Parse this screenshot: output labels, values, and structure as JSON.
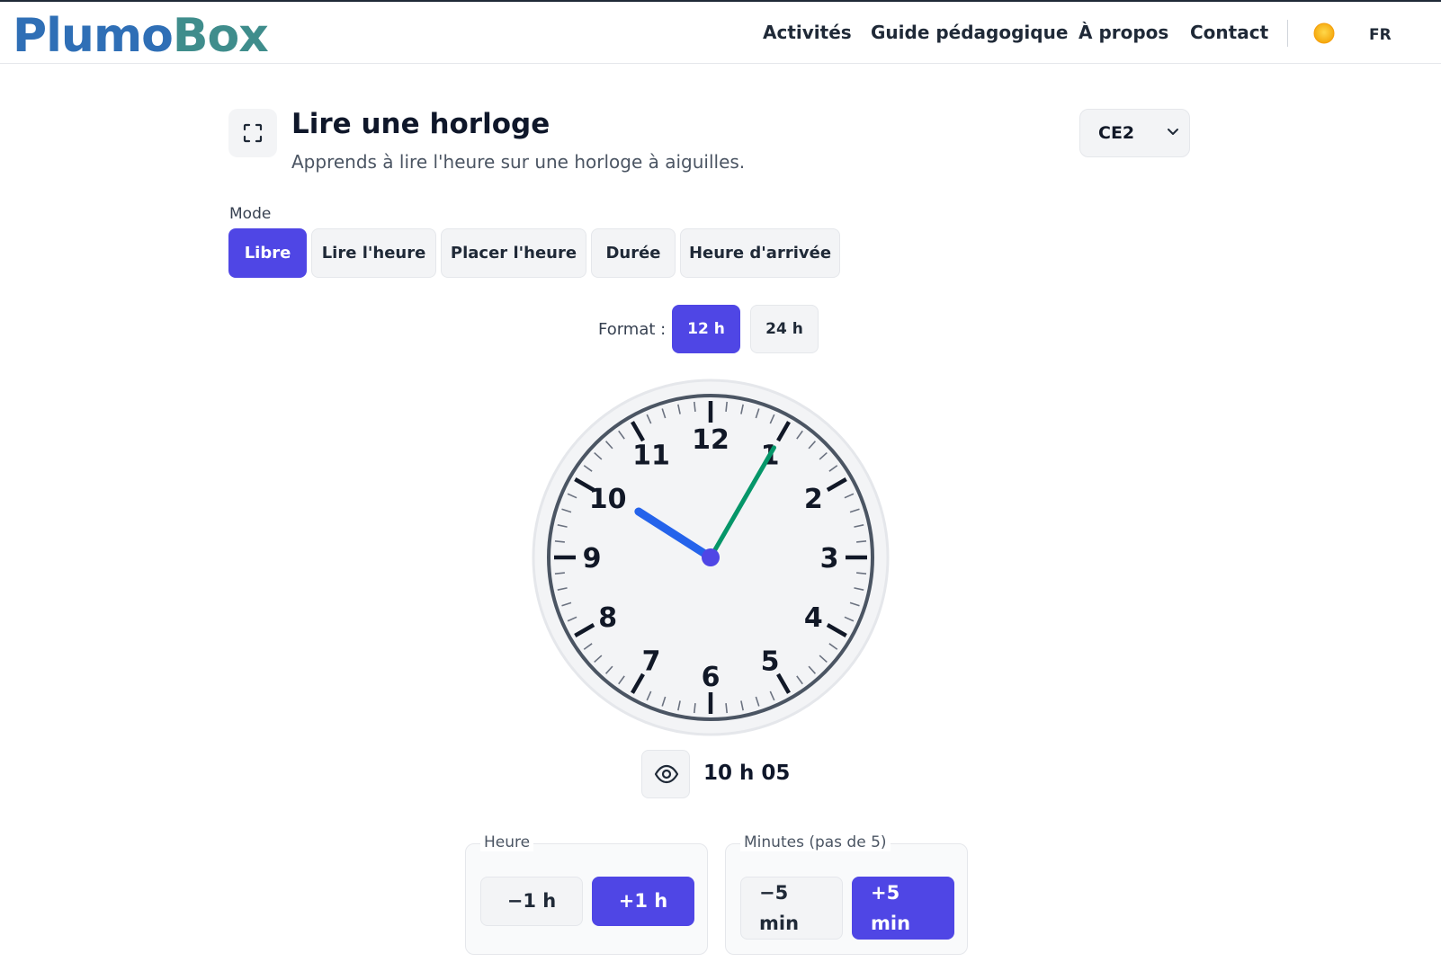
{
  "brand": {
    "part1": "Plumo",
    "part2": "Box"
  },
  "nav": {
    "activities": "Activités",
    "guide": "Guide pédagogique",
    "about": "À propos",
    "contact": "Contact",
    "language": "FR"
  },
  "header_icons": {
    "theme": "sun-icon"
  },
  "page": {
    "title": "Lire une horloge",
    "subtitle": "Apprends à lire l'heure sur une horloge à aiguilles.",
    "fullscreen_icon": "fullscreen-icon",
    "level_selected": "CE2"
  },
  "mode": {
    "label": "Mode",
    "options": [
      "Libre",
      "Lire l'heure",
      "Placer l'heure",
      "Durée",
      "Heure d'arrivée"
    ],
    "active": "Libre"
  },
  "format": {
    "label": "Format :",
    "options": [
      "12 h",
      "24 h"
    ],
    "active": "12 h"
  },
  "clock": {
    "numbers": [
      "12",
      "1",
      "2",
      "3",
      "4",
      "5",
      "6",
      "7",
      "8",
      "9",
      "10",
      "11"
    ],
    "hour": 10,
    "minute": 5,
    "hour_hand_color": "#2563eb",
    "minute_hand_color": "#059669",
    "center_color": "#4f46e5"
  },
  "display": {
    "time_text": "10 h 05",
    "toggle_icon": "eye-icon"
  },
  "controls": {
    "hour": {
      "legend": "Heure",
      "minus": "−1 h",
      "plus": "+1 h"
    },
    "minutes": {
      "legend": "Minutes (pas de 5)",
      "minus_top": "−5",
      "minus_bottom": "min",
      "plus_top": "+5",
      "plus_bottom": "min"
    }
  },
  "colors": {
    "accent": "#4f46e5",
    "logo_blue": "#2f6fb6",
    "logo_teal": "#3f8d8c"
  }
}
